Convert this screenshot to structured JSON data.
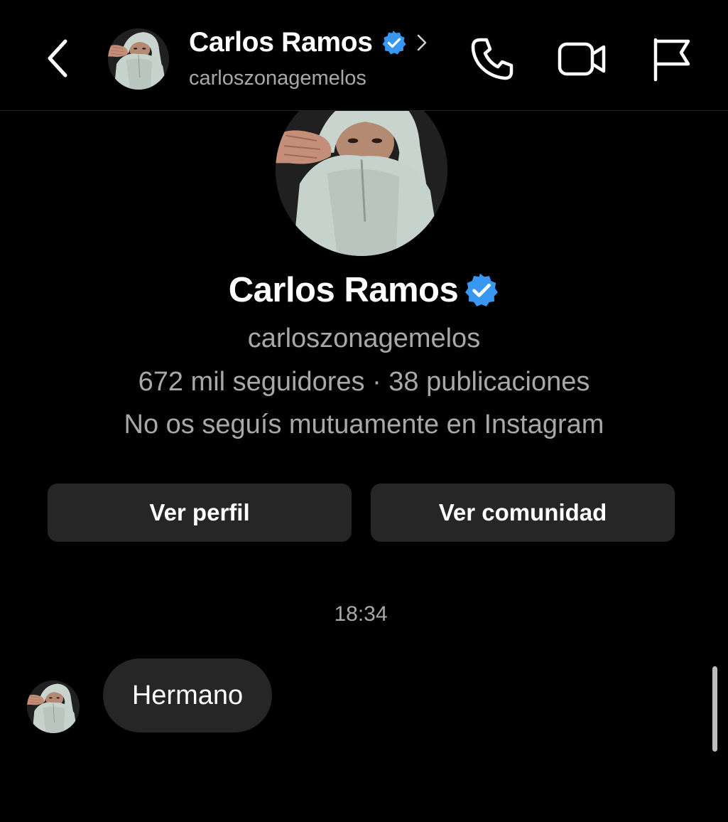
{
  "header": {
    "name": "Carlos Ramos",
    "username": "carloszonagemelos"
  },
  "profile": {
    "name": "Carlos Ramos",
    "username": "carloszonagemelos",
    "stats": "672 mil seguidores · 38 publicaciones",
    "mutual_text": "No os seguís mutuamente en Instagram"
  },
  "buttons": {
    "view_profile": "Ver perfil",
    "view_community": "Ver comunidad"
  },
  "chat": {
    "timestamp": "18:34",
    "messages": [
      {
        "text": "Hermano"
      }
    ]
  },
  "colors": {
    "background": "#000000",
    "verified": "#3897f0",
    "secondary_text": "#a8a8a8",
    "surface": "#262626"
  },
  "icons": {
    "back": "chevron-left-icon",
    "call": "phone-icon",
    "video": "video-camera-icon",
    "report": "flag-icon",
    "verified": "verified-badge-icon"
  }
}
